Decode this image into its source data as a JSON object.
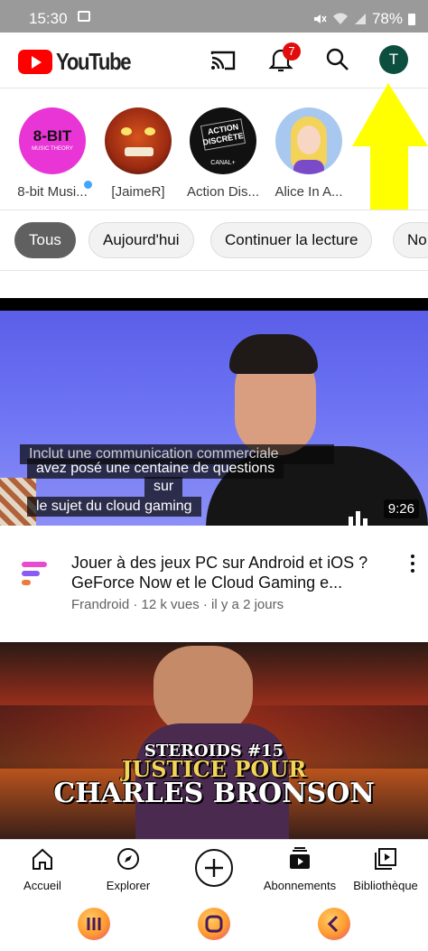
{
  "status_bar": {
    "time": "15:30",
    "battery": "78%"
  },
  "header": {
    "app_name": "YouTube",
    "notification_count": "7",
    "account_initial": "T"
  },
  "subscriptions": [
    {
      "name": "8-bit Musi...",
      "logo_line1": "8-BIT",
      "logo_line2": "MUSIC THEORY"
    },
    {
      "name": "[JaimeR]"
    },
    {
      "name": "Action Dis...",
      "logo_line1": "ACTION",
      "logo_line2": "DISCRÈTE",
      "logo_line3": "CANAL+"
    },
    {
      "name": "Alice In A..."
    }
  ],
  "chips": [
    "Tous",
    "Aujourd'hui",
    "Continuer la lecture",
    "No"
  ],
  "video1": {
    "overlay_notice": "Inclut une communication commerciale",
    "caption_lines": [
      "avez posé une centaine de questions",
      "sur",
      "le sujet du cloud gaming"
    ],
    "duration": "9:26",
    "title": "Jouer à des jeux PC sur Android et iOS ? GeForce Now et le Cloud Gaming e...",
    "meta": "Frandroid · 12 k vues · il y a 2 jours"
  },
  "video2": {
    "title_line1": "STEROIDS #15",
    "title_line2": "JUSTICE POUR",
    "title_line3": "CHARLES BRONSON"
  },
  "bottom_nav": [
    "Accueil",
    "Explorer",
    "Abonnements",
    "Bibliothèque"
  ],
  "colors": {
    "brand_red": "#ff0000",
    "annotation_arrow": "#ffff00",
    "avatar_bg": "#0d4f3f"
  }
}
